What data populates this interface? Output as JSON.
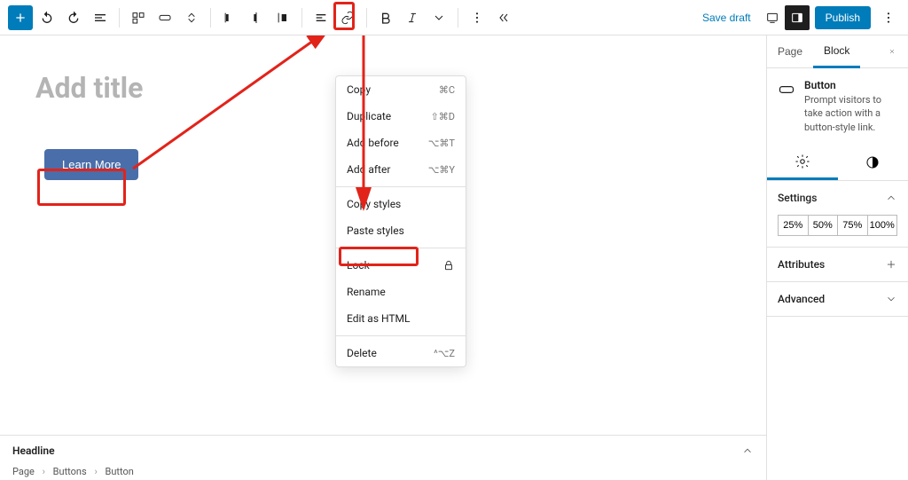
{
  "toolbar": {
    "save_draft": "Save draft",
    "publish": "Publish"
  },
  "editor": {
    "title_placeholder": "Add title",
    "button_label": "Learn More",
    "headline_label": "Headline"
  },
  "menu": {
    "copy": {
      "label": "Copy",
      "kbd": "⌘C"
    },
    "duplicate": {
      "label": "Duplicate",
      "kbd": "⇧⌘D"
    },
    "add_before": {
      "label": "Add before",
      "kbd": "⌥⌘T"
    },
    "add_after": {
      "label": "Add after",
      "kbd": "⌥⌘Y"
    },
    "copy_styles": {
      "label": "Copy styles"
    },
    "paste_styles": {
      "label": "Paste styles"
    },
    "lock": {
      "label": "Lock"
    },
    "rename": {
      "label": "Rename"
    },
    "edit_html": {
      "label": "Edit as HTML"
    },
    "delete": {
      "label": "Delete",
      "kbd": "^⌥Z"
    }
  },
  "sidebar": {
    "tab_page": "Page",
    "tab_block": "Block",
    "block_name": "Button",
    "block_desc": "Prompt visitors to take action with a button-style link.",
    "panel_settings": "Settings",
    "width_opts": [
      "25%",
      "50%",
      "75%",
      "100%"
    ],
    "panel_attributes": "Attributes",
    "panel_advanced": "Advanced"
  },
  "breadcrumb": {
    "a": "Page",
    "b": "Buttons",
    "c": "Button"
  }
}
